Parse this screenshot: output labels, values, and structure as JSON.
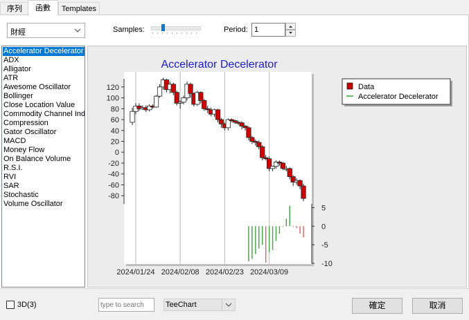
{
  "tabs": [
    {
      "label": "序列",
      "active": false
    },
    {
      "label": "函數",
      "active": true
    },
    {
      "label": "Templates",
      "active": false
    }
  ],
  "toolbar": {
    "function_value": "財經",
    "samples_label": "Samples:",
    "period_label": "Period:",
    "period_value": "1"
  },
  "functions": [
    "Accelerator Decelerator",
    "ADX",
    "Alligator",
    "ATR",
    "Awesome Oscillator",
    "Bollinger",
    "Close Location Value",
    "Commodity Channel Index",
    "Compression",
    "Gator Oscillator",
    "MACD",
    "Money Flow",
    "On Balance Volume",
    "R.S.I.",
    "RVI",
    "SAR",
    "Stochastic",
    "Volume Oscillator"
  ],
  "selected_function": 0,
  "chart_data": {
    "type": "candlestick+histogram",
    "title": "Accelerator Decelerator",
    "legend_position": "top-right",
    "legend": [
      {
        "name": "Data",
        "color": "#cc0000"
      },
      {
        "name": "Accelerator Decelerator",
        "color": "#3aa63a"
      }
    ],
    "x_ticks": [
      "2024/01/24",
      "2024/02/08",
      "2024/02/23",
      "2024/03/09"
    ],
    "y_ticks": [
      120,
      100,
      80,
      60,
      40,
      20,
      0,
      -20,
      -40,
      -60,
      -80
    ],
    "ylim": [
      -95,
      135
    ],
    "y2_ticks": [
      5,
      0,
      -5,
      -10
    ],
    "y2lim": [
      -10,
      6
    ],
    "grid": true,
    "candles": [
      [
        55,
        75,
        50,
        82
      ],
      [
        75,
        85,
        70,
        90
      ],
      [
        85,
        80,
        76,
        90
      ],
      [
        80,
        82,
        78,
        86
      ],
      [
        82,
        78,
        74,
        86
      ],
      [
        78,
        85,
        75,
        88
      ],
      [
        85,
        83,
        80,
        88
      ],
      [
        83,
        103,
        82,
        105
      ],
      [
        103,
        120,
        100,
        125
      ],
      [
        120,
        133,
        115,
        137
      ],
      [
        133,
        115,
        110,
        135
      ],
      [
        115,
        125,
        108,
        130
      ],
      [
        125,
        110,
        105,
        128
      ],
      [
        110,
        90,
        86,
        113
      ],
      [
        90,
        92,
        80,
        95
      ],
      [
        92,
        100,
        88,
        104
      ],
      [
        100,
        125,
        95,
        130
      ],
      [
        125,
        108,
        100,
        128
      ],
      [
        108,
        88,
        84,
        110
      ],
      [
        88,
        110,
        85,
        113
      ],
      [
        110,
        95,
        90,
        112
      ],
      [
        95,
        80,
        76,
        98
      ],
      [
        80,
        78,
        72,
        85
      ],
      [
        78,
        70,
        66,
        82
      ],
      [
        70,
        78,
        65,
        80
      ],
      [
        78,
        60,
        55,
        80
      ],
      [
        60,
        52,
        45,
        63
      ],
      [
        52,
        45,
        40,
        55
      ],
      [
        45,
        60,
        40,
        62
      ],
      [
        60,
        58,
        55,
        62
      ],
      [
        58,
        55,
        52,
        60
      ],
      [
        55,
        54,
        50,
        58
      ],
      [
        54,
        48,
        42,
        57
      ],
      [
        48,
        45,
        40,
        50
      ],
      [
        45,
        27,
        22,
        48
      ],
      [
        27,
        20,
        15,
        30
      ],
      [
        20,
        18,
        12,
        23
      ],
      [
        18,
        10,
        5,
        22
      ],
      [
        10,
        -10,
        -15,
        13
      ],
      [
        -10,
        -12,
        -15,
        -5
      ],
      [
        -12,
        -30,
        -35,
        -8
      ],
      [
        -30,
        -26,
        -35,
        -25
      ],
      [
        -26,
        -18,
        -30,
        -15
      ],
      [
        -18,
        -20,
        -25,
        -15
      ],
      [
        -20,
        -30,
        -33,
        -18
      ],
      [
        -30,
        -30,
        -35,
        -25
      ],
      [
        -30,
        -45,
        -50,
        -28
      ],
      [
        -45,
        -55,
        -62,
        -42
      ],
      [
        -55,
        -52,
        -60,
        -48
      ],
      [
        -52,
        -62,
        -68,
        -50
      ],
      [
        -62,
        -85,
        -90,
        -58
      ]
    ],
    "histogram": [
      -9.5,
      -8.8,
      -7.5,
      -6.0,
      -5.0,
      -9.8,
      -7.0,
      -6.4,
      -4.0,
      -2.0,
      0.0,
      2.0,
      5.5,
      0.0,
      -0.5,
      -2.0,
      -3.0
    ],
    "histogram_start_index": 34
  },
  "bottom": {
    "checkbox_label": "3D(3)",
    "search_placeholder": "type to search",
    "theme_value": "TeeChart",
    "ok_label": "確定",
    "cancel_label": "取消"
  }
}
